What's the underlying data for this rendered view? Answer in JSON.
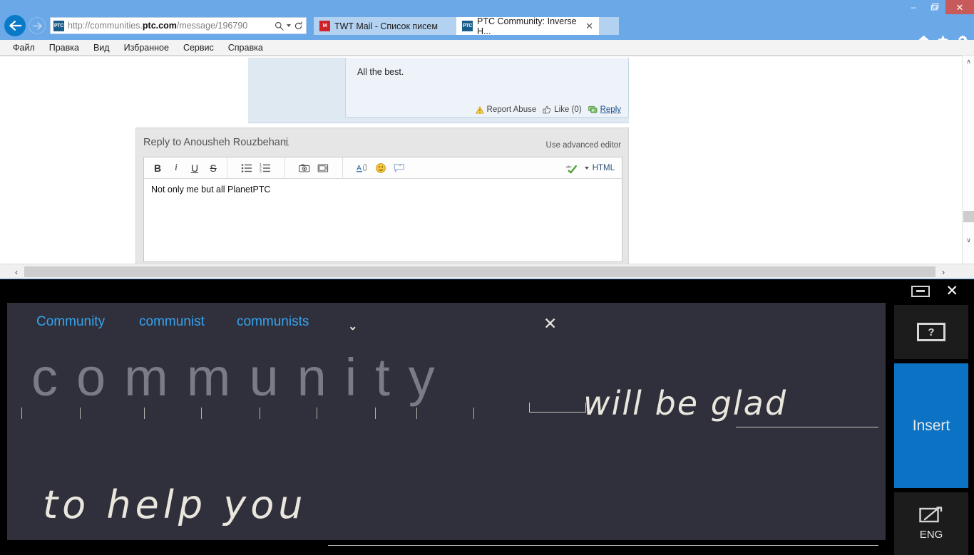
{
  "browser": {
    "window_controls": {
      "minimize": "–",
      "restore": "❐",
      "close": "✕"
    },
    "address": {
      "scheme": "http://communities.",
      "domain": "ptc.com",
      "path": "/message/196790",
      "full": "http://communities.ptc.com/message/196790",
      "site_badge": "PTC"
    },
    "tabs": [
      {
        "title": "TWT Mail - Список писем",
        "favicon": "mail-icon",
        "active": false,
        "close": ""
      },
      {
        "title": "PTC Community: Inverse H...",
        "favicon": "ptc-icon",
        "active": true,
        "close": "✕"
      }
    ],
    "toolbar_icons": [
      "home-icon",
      "favorites-star-icon",
      "settings-gear-icon"
    ],
    "menu": [
      "Файл",
      "Правка",
      "Вид",
      "Избранное",
      "Сервис",
      "Справка"
    ],
    "scrollbars": {
      "v_up": "∧",
      "v_down": "∨",
      "h_left": "‹",
      "h_right": "›"
    }
  },
  "page": {
    "message": {
      "body": "All the best.",
      "actions": {
        "report_abuse": "Report Abuse",
        "like": "Like (0)",
        "reply": "Reply"
      }
    },
    "reply_editor": {
      "title": "Reply to Anousheh Rouzbehani",
      "advanced_link": "Use advanced editor",
      "toolbar": {
        "bold": "B",
        "italic": "i",
        "underline": "U",
        "strike": "S",
        "bullet_list": "bullet-list-icon",
        "numbered_list": "numbered-list-icon",
        "insert_image": "camera-icon",
        "insert_video": "video-icon",
        "font_color": "A",
        "emoticon": "smiley-icon",
        "quote": "quote-icon",
        "spellcheck": "abc",
        "spellcheck_caret": "▾",
        "html": "HTML"
      },
      "content": "Not only me but all PlanetPTC"
    }
  },
  "handwriting_panel": {
    "window": {
      "minimize": "minimize-icon",
      "close": "✕"
    },
    "suggestions": [
      "Community",
      "communist",
      "communists"
    ],
    "suggestions_more": "⌄",
    "suggestions_close": "✕",
    "recognized_word": "community",
    "ink_line_1": "will be glad",
    "ink_line_2": "to help you",
    "buttons": {
      "help": "?",
      "insert": "Insert",
      "language": "ENG",
      "language_icon": "pen-pad-icon"
    },
    "colors": {
      "canvas": "#30303c",
      "accent": "#0b72c4",
      "suggestion_text": "#35a4f0",
      "ink": "#e9e6dd",
      "recognized": "#7b7b88"
    }
  }
}
